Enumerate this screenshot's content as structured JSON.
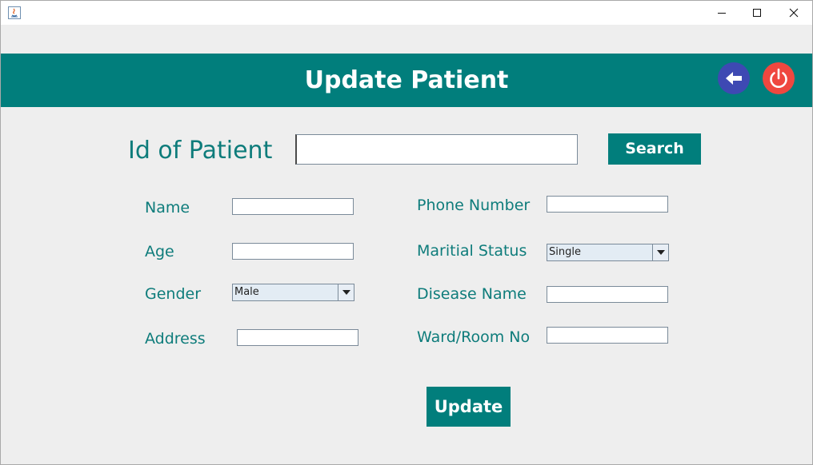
{
  "window": {
    "controls": {
      "minimize": "minimize-icon",
      "maximize": "maximize-icon",
      "close": "close-icon"
    }
  },
  "header": {
    "title": "Update Patient",
    "back_icon": "arrow-left-icon",
    "power_icon": "power-icon",
    "colors": {
      "bar": "#017e7c",
      "back": "#3e49b3",
      "power": "#ef473f"
    }
  },
  "search": {
    "label": "Id of Patient",
    "value": "",
    "button_label": "Search"
  },
  "form": {
    "name": {
      "label": "Name",
      "value": ""
    },
    "age": {
      "label": "Age",
      "value": ""
    },
    "gender": {
      "label": "Gender",
      "selected": "Male"
    },
    "address": {
      "label": "Address",
      "value": ""
    },
    "phone": {
      "label": "Phone Number",
      "value": ""
    },
    "marital_status": {
      "label": "Maritial Status",
      "selected": "Single"
    },
    "disease": {
      "label": "Disease Name",
      "value": ""
    },
    "ward": {
      "label": "Ward/Room No",
      "value": ""
    }
  },
  "actions": {
    "update_label": "Update"
  }
}
